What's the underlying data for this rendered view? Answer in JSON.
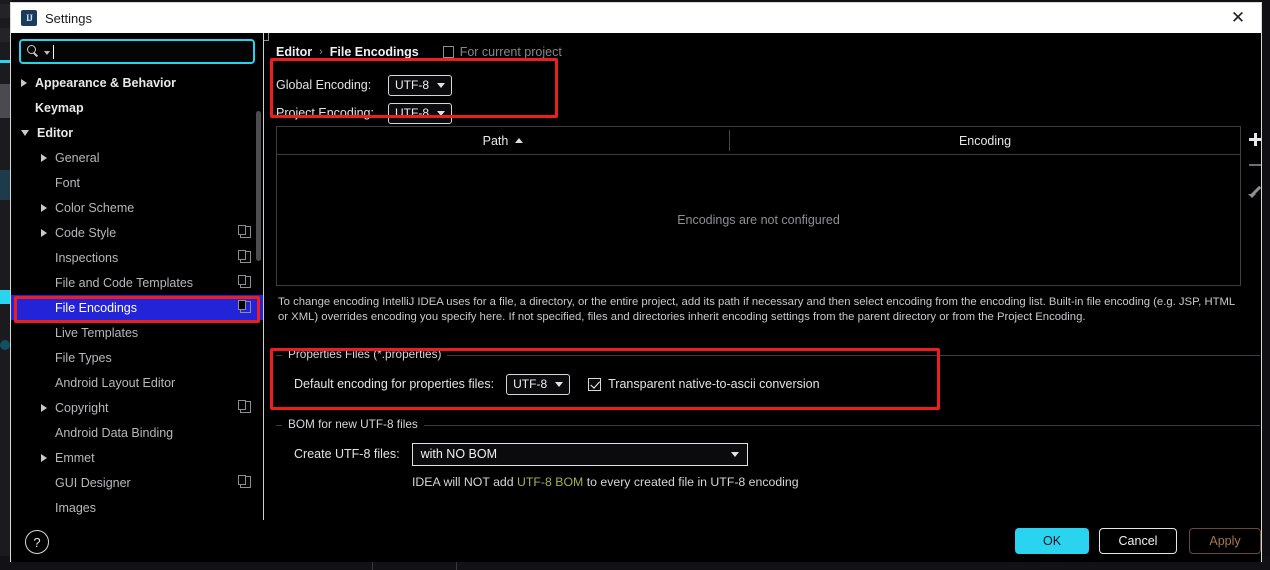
{
  "window": {
    "title": "Settings",
    "icon": "intellij-idea-logo-icon",
    "close_label": "✕"
  },
  "search": {
    "value": "",
    "placeholder": "",
    "icon": "search-icon"
  },
  "sidebar": {
    "items": [
      {
        "label": "Appearance & Behavior",
        "arrow": "collapsed",
        "level": 0,
        "top": true,
        "badge": false,
        "selected": false
      },
      {
        "label": "Keymap",
        "arrow": "none",
        "level": 0,
        "top": true,
        "badge": false,
        "selected": false
      },
      {
        "label": "Editor",
        "arrow": "expanded",
        "level": 0,
        "top": true,
        "badge": false,
        "selected": false
      },
      {
        "label": "General",
        "arrow": "collapsed",
        "level": 1,
        "top": false,
        "badge": false,
        "selected": false
      },
      {
        "label": "Font",
        "arrow": "none",
        "level": 1,
        "top": false,
        "badge": false,
        "selected": false
      },
      {
        "label": "Color Scheme",
        "arrow": "collapsed",
        "level": 1,
        "top": false,
        "badge": false,
        "selected": false
      },
      {
        "label": "Code Style",
        "arrow": "collapsed",
        "level": 1,
        "top": false,
        "badge": true,
        "selected": false
      },
      {
        "label": "Inspections",
        "arrow": "none",
        "level": 1,
        "top": false,
        "badge": true,
        "selected": false
      },
      {
        "label": "File and Code Templates",
        "arrow": "none",
        "level": 1,
        "top": false,
        "badge": true,
        "selected": false
      },
      {
        "label": "File Encodings",
        "arrow": "none",
        "level": 1,
        "top": false,
        "badge": true,
        "selected": true
      },
      {
        "label": "Live Templates",
        "arrow": "none",
        "level": 1,
        "top": false,
        "badge": false,
        "selected": false
      },
      {
        "label": "File Types",
        "arrow": "none",
        "level": 1,
        "top": false,
        "badge": false,
        "selected": false
      },
      {
        "label": "Android Layout Editor",
        "arrow": "none",
        "level": 1,
        "top": false,
        "badge": false,
        "selected": false
      },
      {
        "label": "Copyright",
        "arrow": "collapsed",
        "level": 1,
        "top": false,
        "badge": true,
        "selected": false
      },
      {
        "label": "Android Data Binding",
        "arrow": "none",
        "level": 1,
        "top": false,
        "badge": false,
        "selected": false
      },
      {
        "label": "Emmet",
        "arrow": "collapsed",
        "level": 1,
        "top": false,
        "badge": false,
        "selected": false
      },
      {
        "label": "GUI Designer",
        "arrow": "none",
        "level": 1,
        "top": false,
        "badge": true,
        "selected": false
      },
      {
        "label": "Images",
        "arrow": "none",
        "level": 1,
        "top": false,
        "badge": false,
        "selected": false
      }
    ]
  },
  "breadcrumb": {
    "parent": "Editor",
    "separator": "›",
    "current": "File Encodings",
    "project_scope": "For current project",
    "project_scope_icon": "project-scope-icon"
  },
  "encodings": {
    "global_label": "Global Encoding:",
    "global_value": "UTF-8",
    "project_label": "Project Encoding:",
    "project_value": "UTF-8"
  },
  "table": {
    "columns": [
      "Path",
      "Encoding"
    ],
    "sort_column": "Path",
    "sort_direction": "ascending",
    "empty_message": "Encodings are not configured",
    "rows": [],
    "toolbar": [
      {
        "name": "add-row-button",
        "icon": "plus-icon",
        "enabled": true
      },
      {
        "name": "remove-row-button",
        "icon": "minus-icon",
        "enabled": false
      },
      {
        "name": "edit-row-button",
        "icon": "pencil-icon",
        "enabled": false
      }
    ]
  },
  "hint_text": "To change encoding IntelliJ IDEA uses for a file, a directory, or the entire project, add its path if necessary and then select encoding from the encoding list. Built-in file encoding (e.g. JSP, HTML or XML) overrides encoding you specify here. If not specified, files and directories inherit encoding settings from the parent directory or from the Project Encoding.",
  "properties_section": {
    "title": "Properties Files (*.properties)",
    "default_encoding_label": "Default encoding for properties files:",
    "default_encoding_value": "UTF-8",
    "transparent_label": "Transparent native-to-ascii conversion",
    "transparent_checked": true
  },
  "bom_section": {
    "title": "BOM for new UTF-8 files",
    "create_label": "Create UTF-8 files:",
    "create_value": "with NO BOM",
    "note_prefix": "IDEA will NOT add ",
    "note_accent": "UTF-8 BOM",
    "note_suffix": " to every created file in UTF-8 encoding"
  },
  "footer": {
    "help_label": "?",
    "ok_label": "OK",
    "cancel_label": "Cancel",
    "apply_label": "Apply",
    "apply_enabled": false
  },
  "colors": {
    "accent_cyan": "#2ad4f0",
    "highlight_red": "#ef1e1e",
    "selection_blue": "#2323d8",
    "bom_accent": "#a4b04f",
    "apply_disabled": "#a6764e"
  }
}
